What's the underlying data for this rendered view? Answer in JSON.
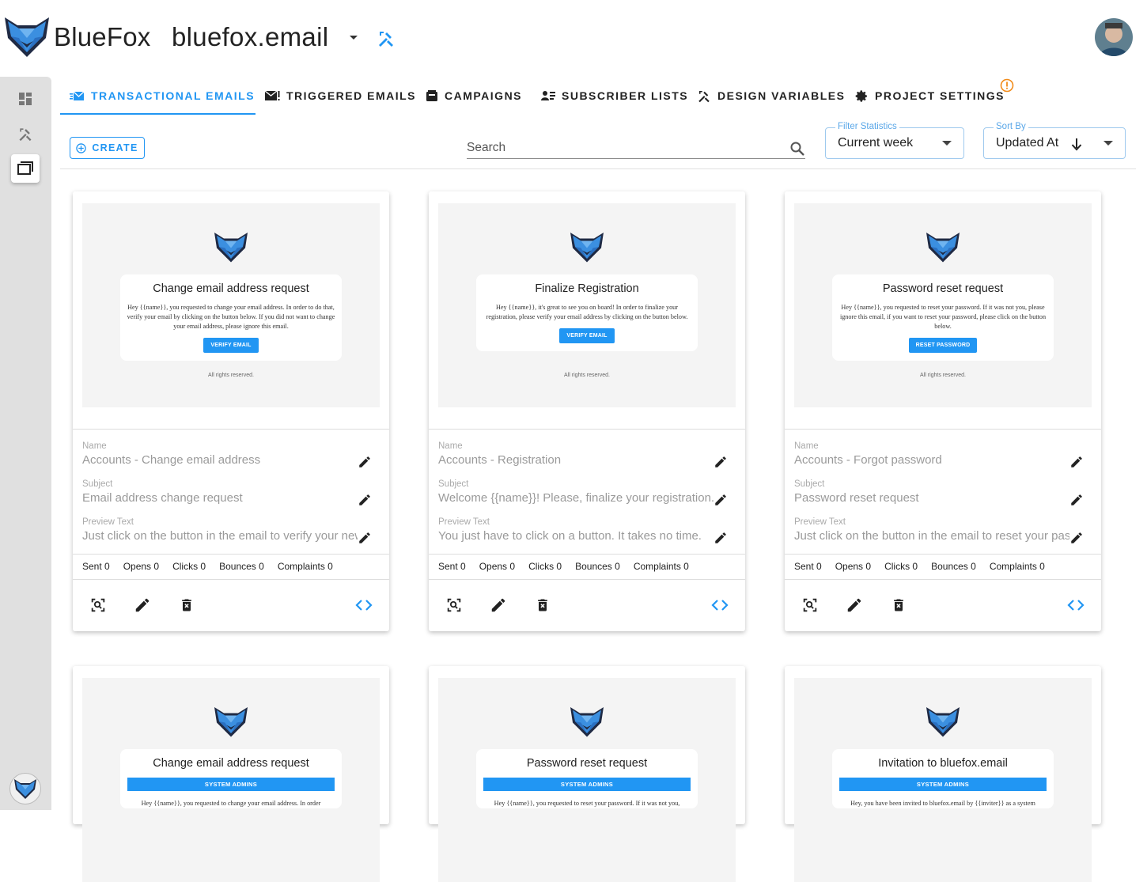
{
  "header": {
    "brand": "BlueFox",
    "project": "bluefox.email"
  },
  "colors": {
    "accent": "#2196f3",
    "warning": "#f28c1b",
    "rail": "#e0e0e0"
  },
  "rail": {
    "items": [
      "dashboard-icon",
      "design-tools-icon",
      "projects-icon"
    ],
    "active": "projects-icon"
  },
  "tabs": [
    {
      "label": "TRANSACTIONAL EMAILS",
      "icon": "transactional-email-icon",
      "active": true
    },
    {
      "label": "TRIGGERED EMAILS",
      "icon": "triggered-email-icon"
    },
    {
      "label": "CAMPAIGNS",
      "icon": "campaign-icon"
    },
    {
      "label": "SUBSCRIBER LISTS",
      "icon": "subscribers-icon"
    },
    {
      "label": "DESIGN VARIABLES",
      "icon": "design-icon"
    },
    {
      "label": "PROJECT SETTINGS",
      "icon": "gear-icon"
    }
  ],
  "toolbar": {
    "create_label": "CREATE",
    "search_placeholder": "Search",
    "filter": {
      "label": "Filter Statistics",
      "value": "Current week"
    },
    "sort": {
      "label": "Sort By",
      "value": "Updated At"
    }
  },
  "cards": [
    {
      "preview_title": "Change email address request",
      "preview_body": "Hey {{name}}, you requested to change your email address. In order to do that, verify your email by clicking on the button below. If you did not want to change your email address, please ignore this email.",
      "preview_button": "VERIFY EMAIL",
      "preview_footer": "All rights reserved.",
      "name_label": "Name",
      "name": "Accounts - Change email address",
      "subject_label": "Subject",
      "subject": "Email address change request",
      "preview_label": "Preview Text",
      "preview_text": "Just click on the button in the email to verify your new email address.",
      "stats": {
        "sent": "Sent 0",
        "opens": "Opens 0",
        "clicks": "Clicks 0",
        "bounces": "Bounces 0",
        "complaints": "Complaints 0"
      }
    },
    {
      "preview_title": "Finalize Registration",
      "preview_body": "Hey {{name}}, it's great to see you on board! In order to finalize your registration, please verify your email address by clicking on the button below.",
      "preview_button": "VERIFY EMAIL",
      "preview_footer": "All rights reserved.",
      "name_label": "Name",
      "name": "Accounts - Registration",
      "subject_label": "Subject",
      "subject": "Welcome {{name}}! Please, finalize your registration.",
      "preview_label": "Preview Text",
      "preview_text": "You just have to click on a button. It takes no time.",
      "stats": {
        "sent": "Sent 0",
        "opens": "Opens 0",
        "clicks": "Clicks 0",
        "bounces": "Bounces 0",
        "complaints": "Complaints 0"
      }
    },
    {
      "preview_title": "Password reset request",
      "preview_body": "Hey {{name}}, you requested to reset your password. If it was not you, please ignore this email, if you want to reset your password, please click on the button below.",
      "preview_button": "RESET PASSWORD",
      "preview_footer": "All rights reserved.",
      "name_label": "Name",
      "name": "Accounts - Forgot password",
      "subject_label": "Subject",
      "subject": "Password reset request",
      "preview_label": "Preview Text",
      "preview_text": "Just click on the button in the email to reset your password.",
      "stats": {
        "sent": "Sent 0",
        "opens": "Opens 0",
        "clicks": "Clicks 0",
        "bounces": "Bounces 0",
        "complaints": "Complaints 0"
      }
    },
    {
      "preview_title": "Change email address request",
      "preview_badge": "SYSTEM ADMINS",
      "preview_body": "Hey {{name}}, you requested to change your email address. In order"
    },
    {
      "preview_title": "Password reset request",
      "preview_badge": "SYSTEM ADMINS",
      "preview_body": "Hey {{name}}, you requested to reset your password. If it was not you,"
    },
    {
      "preview_title": "Invitation to bluefox.email",
      "preview_badge": "SYSTEM ADMINS",
      "preview_body": "Hey, you have been invited to bluefox.email by {{inviter}} as a system"
    }
  ]
}
